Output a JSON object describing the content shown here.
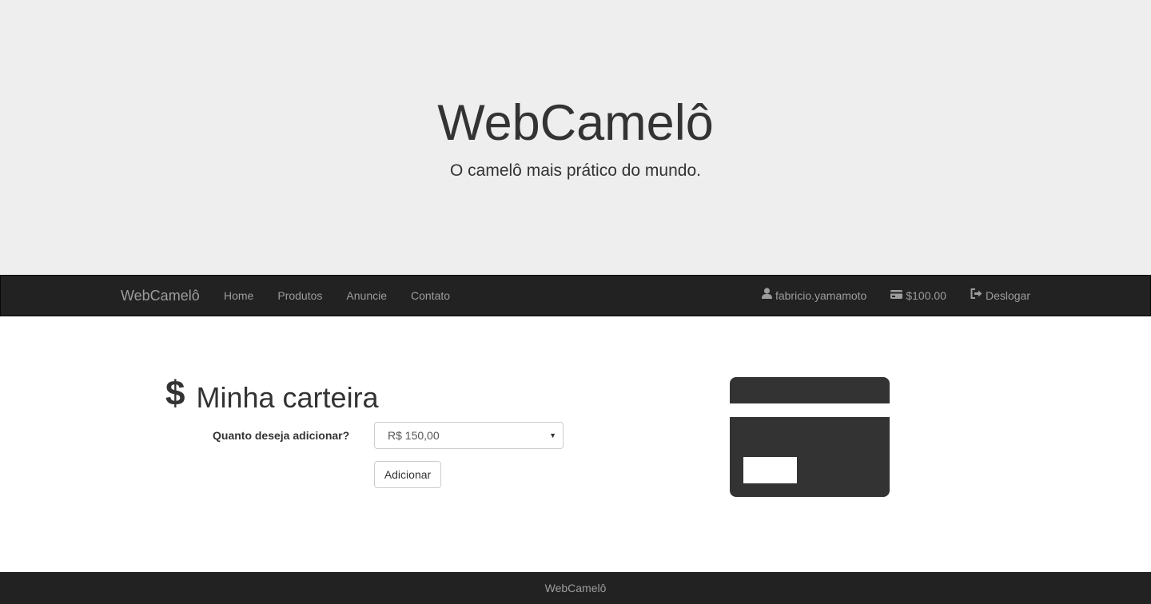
{
  "hero": {
    "title": "WebCamelô",
    "subtitle": "O camelô mais prático do mundo."
  },
  "navbar": {
    "brand": "WebCamelô",
    "links": [
      {
        "label": "Home"
      },
      {
        "label": "Produtos"
      },
      {
        "label": "Anuncie"
      },
      {
        "label": "Contato"
      }
    ],
    "user": {
      "icon": "user-icon",
      "label": "fabricio.yamamoto"
    },
    "balance": {
      "icon": "credit-card-icon",
      "label": "$100.00"
    },
    "logout": {
      "icon": "logout-icon",
      "label": "Deslogar"
    }
  },
  "wallet": {
    "icon_symbol": "$",
    "title": "Minha carteira",
    "amount_label": "Quanto deseja adicionar?",
    "amount_selected": "R$ 150,00",
    "add_button": "Adicionar",
    "illustration": "credit-card-illustration"
  },
  "footer": {
    "text": "WebCamelô"
  },
  "colors": {
    "hero_bg": "#eeeeee",
    "navbar_bg": "#222222",
    "nav_text": "#9d9d9d",
    "text": "#333333"
  }
}
